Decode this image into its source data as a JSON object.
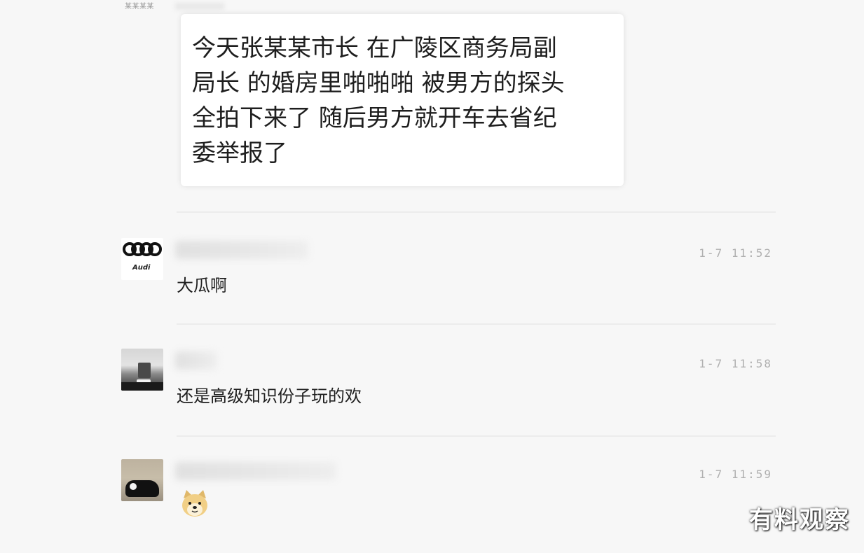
{
  "header": {
    "top_label": "某某某某"
  },
  "post": {
    "text": "今天张某某市长 在广陵区商务局副\n局长 的婚房里啪啪啪 被男方的探头\n全拍下来了 随后男方就开车去省纪\n委举报了"
  },
  "comments": [
    {
      "timestamp": "1-7 11:52",
      "text": "大瓜啊",
      "avatar_icon": "audi-rings-avatar",
      "avatar_brand": "Audi"
    },
    {
      "timestamp": "1-7 11:58",
      "text": "还是高级知识份子玩的欢",
      "avatar_icon": "photo-avatar"
    },
    {
      "timestamp": "1-7 11:59",
      "text": "",
      "avatar_icon": "cat-avatar",
      "emoji_icon": "doge-emoji-icon"
    }
  ],
  "watermark": "有料观察",
  "colors": {
    "background": "#f7f7f7",
    "bubble": "#ffffff",
    "timestamp": "#b0b0b0",
    "text": "#202020"
  }
}
